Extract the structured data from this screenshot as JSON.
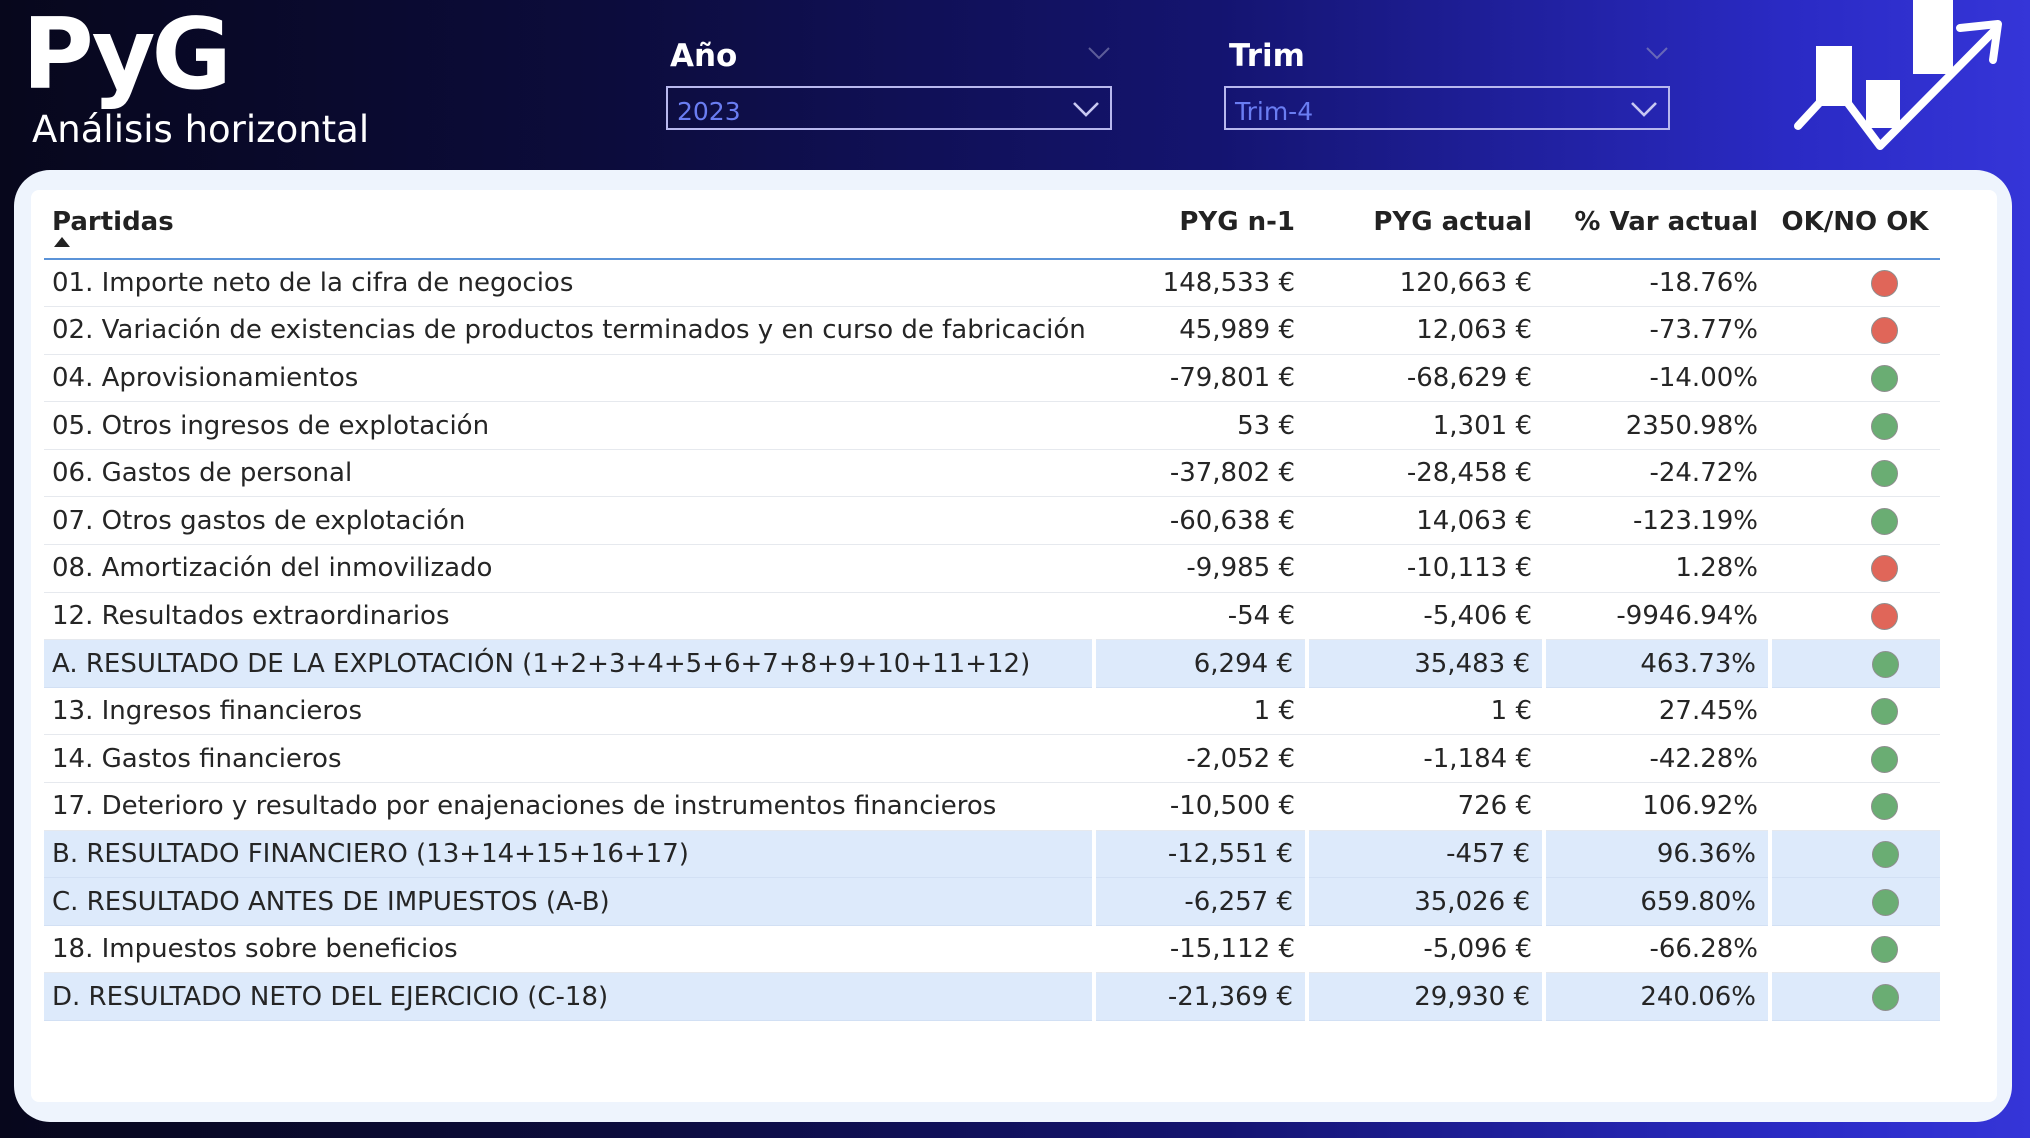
{
  "header": {
    "title": "PyG",
    "subtitle": "Análisis horizontal"
  },
  "filters": {
    "year": {
      "label": "Año",
      "value": "2023"
    },
    "quarter": {
      "label": "Trim",
      "value": "Trim-4"
    }
  },
  "logo": {
    "icon": "growth-chart-arrow-icon"
  },
  "colors": {
    "ok": "#6aad73",
    "not_ok": "#e06659",
    "accent": "#6a7df2"
  },
  "table": {
    "columns": [
      "Partidas",
      "PYG n-1",
      "PYG actual",
      "% Var actual",
      "OK/NO OK"
    ],
    "rows": [
      {
        "name": "01. Importe neto de la cifra de negocios",
        "prev": "148,533 €",
        "curr": "120,663 €",
        "var": "-18.76%",
        "status": "not_ok",
        "highlight": false
      },
      {
        "name": "02. Variación de existencias de productos terminados y en curso de fabricación",
        "prev": "45,989 €",
        "curr": "12,063 €",
        "var": "-73.77%",
        "status": "not_ok",
        "highlight": false
      },
      {
        "name": "04. Aprovisionamientos",
        "prev": "-79,801 €",
        "curr": "-68,629 €",
        "var": "-14.00%",
        "status": "ok",
        "highlight": false
      },
      {
        "name": "05. Otros ingresos de explotación",
        "prev": "53 €",
        "curr": "1,301 €",
        "var": "2350.98%",
        "status": "ok",
        "highlight": false
      },
      {
        "name": "06. Gastos de personal",
        "prev": "-37,802 €",
        "curr": "-28,458 €",
        "var": "-24.72%",
        "status": "ok",
        "highlight": false
      },
      {
        "name": "07. Otros gastos de explotación",
        "prev": "-60,638 €",
        "curr": "14,063 €",
        "var": "-123.19%",
        "status": "ok",
        "highlight": false
      },
      {
        "name": "08. Amortización del inmovilizado",
        "prev": "-9,985 €",
        "curr": "-10,113 €",
        "var": "1.28%",
        "status": "not_ok",
        "highlight": false
      },
      {
        "name": "12. Resultados extraordinarios",
        "prev": "-54 €",
        "curr": "-5,406 €",
        "var": "-9946.94%",
        "status": "not_ok",
        "highlight": false
      },
      {
        "name": "A. RESULTADO DE LA EXPLOTACIÓN (1+2+3+4+5+6+7+8+9+10+11+12)",
        "prev": "6,294 €",
        "curr": "35,483 €",
        "var": "463.73%",
        "status": "ok",
        "highlight": true
      },
      {
        "name": "13. Ingresos financieros",
        "prev": "1 €",
        "curr": "1 €",
        "var": "27.45%",
        "status": "ok",
        "highlight": false
      },
      {
        "name": "14. Gastos financieros",
        "prev": "-2,052 €",
        "curr": "-1,184 €",
        "var": "-42.28%",
        "status": "ok",
        "highlight": false
      },
      {
        "name": "17. Deterioro y resultado por enajenaciones de instrumentos financieros",
        "prev": "-10,500 €",
        "curr": "726 €",
        "var": "106.92%",
        "status": "ok",
        "highlight": false
      },
      {
        "name": "B. RESULTADO FINANCIERO (13+14+15+16+17)",
        "prev": "-12,551 €",
        "curr": "-457 €",
        "var": "96.36%",
        "status": "ok",
        "highlight": true
      },
      {
        "name": "C. RESULTADO ANTES DE IMPUESTOS (A-B)",
        "prev": "-6,257 €",
        "curr": "35,026 €",
        "var": "659.80%",
        "status": "ok",
        "highlight": true
      },
      {
        "name": "18. Impuestos sobre beneficios",
        "prev": "-15,112 €",
        "curr": "-5,096 €",
        "var": "-66.28%",
        "status": "ok",
        "highlight": false
      },
      {
        "name": "D. RESULTADO NETO DEL EJERCICIO (C-18)",
        "prev": "-21,369 €",
        "curr": "29,930 €",
        "var": "240.06%",
        "status": "ok",
        "highlight": true
      }
    ]
  }
}
